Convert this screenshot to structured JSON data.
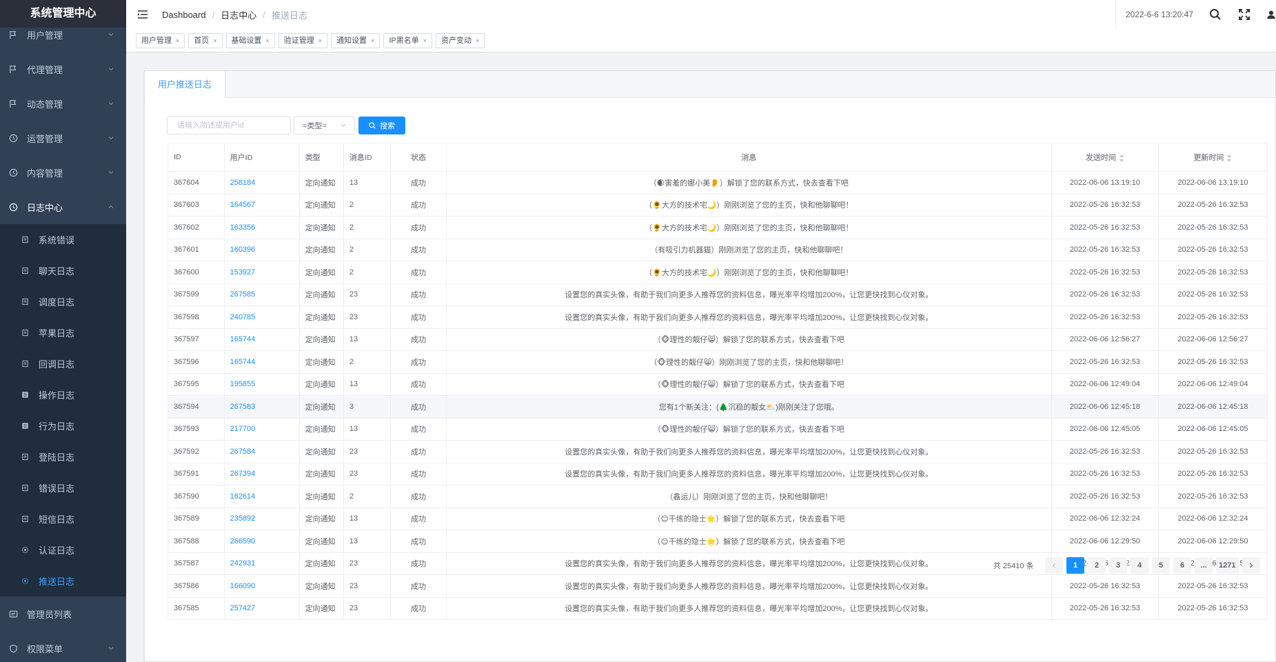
{
  "app": {
    "title": "系统管理中心"
  },
  "sidebar": {
    "top_items": [
      {
        "label": "用户管理",
        "icon": "user-flag-icon"
      },
      {
        "label": "代理管理",
        "icon": "agent-flag-icon"
      },
      {
        "label": "动态管理",
        "icon": "moments-flag-icon"
      },
      {
        "label": "运营管理",
        "icon": "operations-clock-icon"
      },
      {
        "label": "内容管理",
        "icon": "content-clock-icon"
      },
      {
        "label": "日志中心",
        "icon": "log-center-clock-icon"
      }
    ],
    "sub_items": [
      {
        "label": "系统错误",
        "icon": "doc-icon"
      },
      {
        "label": "聊天日志",
        "icon": "doc-icon"
      },
      {
        "label": "调度日志",
        "icon": "doc-icon"
      },
      {
        "label": "苹果日志",
        "icon": "doc-icon"
      },
      {
        "label": "回调日志",
        "icon": "doc-icon"
      },
      {
        "label": "操作日志",
        "icon": "list-icon"
      },
      {
        "label": "行为日志",
        "icon": "list-icon"
      },
      {
        "label": "登陆日志",
        "icon": "doc-icon"
      },
      {
        "label": "错误日志",
        "icon": "doc-icon"
      },
      {
        "label": "短信日志",
        "icon": "doc-icon"
      },
      {
        "label": "认证日志",
        "icon": "badge-icon"
      },
      {
        "label": "推送日志",
        "icon": "badge-icon"
      }
    ],
    "bottom_items": [
      {
        "label": "管理员列表",
        "icon": "admin-list-icon"
      },
      {
        "label": "权限菜单",
        "icon": "shield-icon"
      }
    ]
  },
  "header": {
    "breadcrumb": [
      "Dashboard",
      "日志中心",
      "推送日志"
    ],
    "datetime": "2022-6-6 13:20:47"
  },
  "tags": [
    "用户管理",
    "首页",
    "基础设置",
    "验证管理",
    "通知设置",
    "IP黑名单",
    "资产变动"
  ],
  "card": {
    "tab_label": "用户推送日志"
  },
  "filters": {
    "search_placeholder": "请输入简述或用户id",
    "type_select": "=类型=",
    "search_button": "搜索"
  },
  "table": {
    "columns": [
      "ID",
      "用户ID",
      "类型",
      "消息ID",
      "状态",
      "消息",
      "发送时间",
      "更新时间"
    ],
    "rows": [
      [
        "367604",
        "258184",
        "定向通知",
        "13",
        "成功",
        "（🌒害羞的娜小美👂）解锁了您的联系方式，快去查看下吧",
        "2022-06-06 13:19:10",
        "2022-06-06 13:19:10"
      ],
      [
        "367603",
        "164567",
        "定向通知",
        "2",
        "成功",
        "（🌻大方的技术宅🌙）刚刚浏览了您的主页，快和他聊聊吧！",
        "2022-05-26 16:32:53",
        "2022-05-26 16:32:53"
      ],
      [
        "367602",
        "163356",
        "定向通知",
        "2",
        "成功",
        "（🌻大方的技术宅🌙）刚刚浏览了您的主页，快和他聊聊吧！",
        "2022-05-26 16:32:53",
        "2022-05-26 16:32:53"
      ],
      [
        "367601",
        "160396",
        "定向通知",
        "2",
        "成功",
        "（有吸引力机器猫）刚刚浏览了您的主页，快和他聊聊吧！",
        "2022-05-26 16:32:53",
        "2022-05-26 16:32:53"
      ],
      [
        "367600",
        "153927",
        "定向通知",
        "2",
        "成功",
        "（🌻大方的技术宅🌙）刚刚浏览了您的主页，快和他聊聊吧！",
        "2022-05-26 16:32:53",
        "2022-05-26 16:32:53"
      ],
      [
        "367599",
        "267585",
        "定向通知",
        "23",
        "成功",
        "设置您的真实头像，有助于我们向更多人推荐您的资料信息，曝光率平均增加200%，让您更快找到心仪对象。",
        "2022-05-26 16:32:53",
        "2022-05-26 16:32:53"
      ],
      [
        "367598",
        "240785",
        "定向通知",
        "23",
        "成功",
        "设置您的真实头像，有助于我们向更多人推荐您的资料信息，曝光率平均增加200%，让您更快找到心仪对象。",
        "2022-05-26 16:32:53",
        "2022-05-26 16:32:53"
      ],
      [
        "367597",
        "165744",
        "定向通知",
        "13",
        "成功",
        "（🐵理性的靓仔😸）解锁了您的联系方式，快去查看下吧",
        "2022-06-06 12:56:27",
        "2022-06-06 12:56:27"
      ],
      [
        "367596",
        "165744",
        "定向通知",
        "2",
        "成功",
        "（🐵理性的靓仔😸）刚刚浏览了您的主页，快和他聊聊吧！",
        "2022-05-26 16:32:53",
        "2022-05-26 16:32:53"
      ],
      [
        "367595",
        "195855",
        "定向通知",
        "13",
        "成功",
        "（🐵理性的靓仔😸）解锁了您的联系方式，快去查看下吧",
        "2022-06-06 12:49:04",
        "2022-06-06 12:49:04"
      ],
      [
        "367594",
        "267583",
        "定向通知",
        "3",
        "成功",
        "您有1个新关注：(🌲沉稳的靓女⛅)刚刚关注了您哦。",
        "2022-06-06 12:45:18",
        "2022-06-06 12:45:18"
      ],
      [
        "367593",
        "217700",
        "定向通知",
        "13",
        "成功",
        "（🐵理性的靓仔😸）解锁了您的联系方式，快去查看下吧",
        "2022-06-06 12:45:05",
        "2022-06-06 12:45:05"
      ],
      [
        "367592",
        "267584",
        "定向通知",
        "23",
        "成功",
        "设置您的真实头像，有助于我们向更多人推荐您的资料信息，曝光率平均增加200%，让您更快找到心仪对象。",
        "2022-05-26 16:32:53",
        "2022-05-26 16:32:53"
      ],
      [
        "367591",
        "267394",
        "定向通知",
        "23",
        "成功",
        "设置您的真实头像，有助于我们向更多人推荐您的资料信息，曝光率平均增加200%，让您更快找到心仪对象。",
        "2022-05-26 16:32:53",
        "2022-05-26 16:32:53"
      ],
      [
        "367590",
        "162614",
        "定向通知",
        "2",
        "成功",
        "（鑫运儿）刚刚浏览了您的主页，快和他聊聊吧！",
        "2022-05-26 16:32:53",
        "2022-05-26 16:32:53"
      ],
      [
        "367589",
        "235892",
        "定向通知",
        "13",
        "成功",
        "（😊干练的隐士🌟）解锁了您的联系方式，快去查看下吧",
        "2022-06-06 12:32:24",
        "2022-06-06 12:32:24"
      ],
      [
        "367588",
        "266590",
        "定向通知",
        "13",
        "成功",
        "（😊干练的隐士🌟）解锁了您的联系方式，快去查看下吧",
        "2022-06-06 12:29:50",
        "2022-06-06 12:29:50"
      ],
      [
        "367587",
        "242931",
        "定向通知",
        "23",
        "成功",
        "设置您的真实头像，有助于我们向更多人推荐您的资料信息，曝光率平均增加200%，让您更快找到心仪对象。",
        "2022-05-26 16:32:53",
        "2022-05-26 16:32:53"
      ],
      [
        "367586",
        "166090",
        "定向通知",
        "23",
        "成功",
        "设置您的真实头像，有助于我们向更多人推荐您的资料信息，曝光率平均增加200%，让您更快找到心仪对象。",
        "2022-05-26 16:32:53",
        "2022-05-26 16:32:53"
      ],
      [
        "367585",
        "257427",
        "定向通知",
        "23",
        "成功",
        "设置您的真实头像，有助于我们向更多人推荐您的资料信息，曝光率平均增加200%，让您更快找到心仪对象。",
        "2022-05-26 16:32:53",
        "2022-05-26 16:32:53"
      ]
    ]
  },
  "pagination": {
    "total_text": "共 25410 条",
    "pages": [
      "1",
      "2",
      "3",
      "4",
      "5",
      "6",
      "...",
      "1271"
    ],
    "current": "1"
  }
}
